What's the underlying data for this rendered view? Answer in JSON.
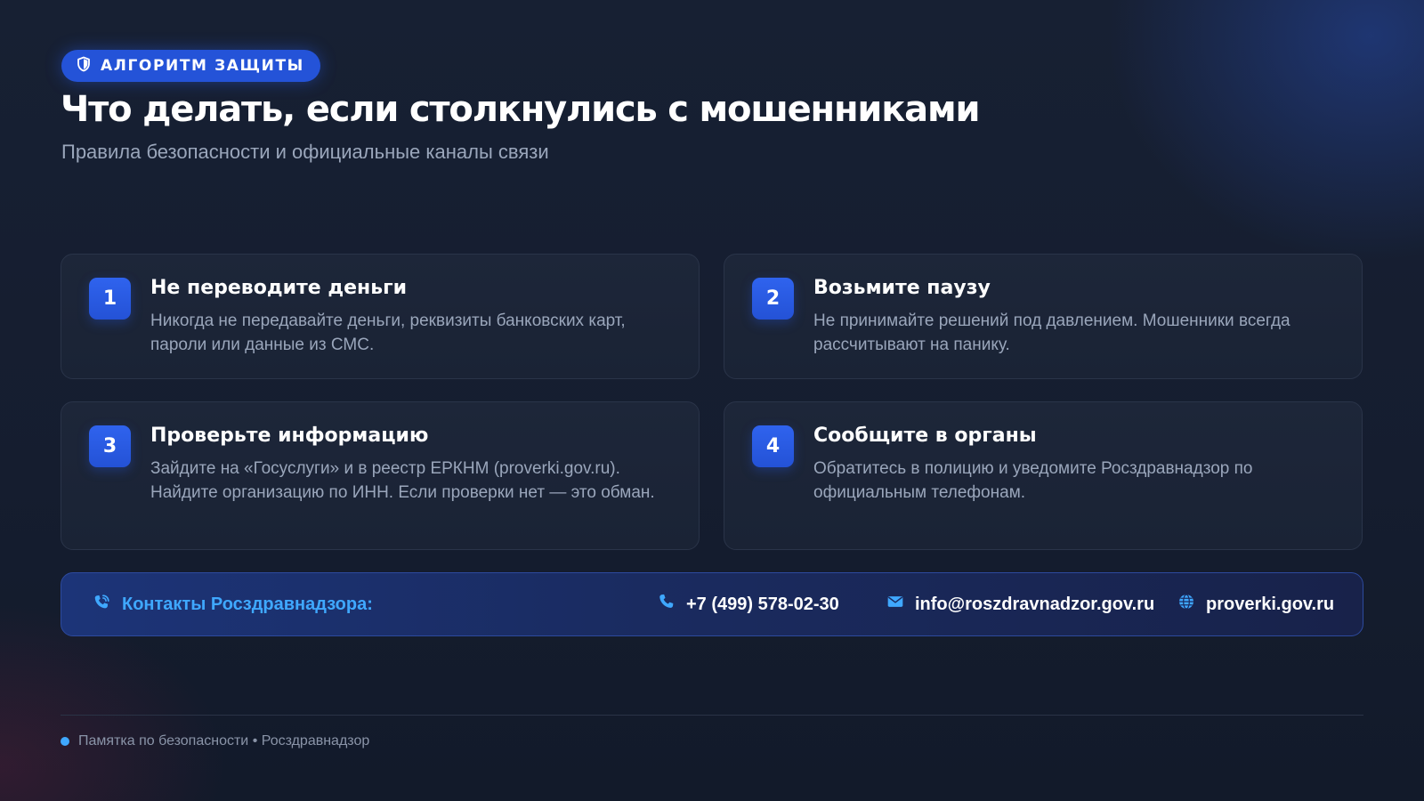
{
  "badge": {
    "label": "АЛГОРИТМ ЗАЩИТЫ",
    "icon": "shield-icon"
  },
  "title": "Что делать, если столкнулись с мошенниками",
  "subtitle": "Правила безопасности и официальные каналы связи",
  "steps": [
    {
      "number": "1",
      "title": "Не переводите деньги",
      "text": "Никогда не передавайте деньги, реквизиты банковских карт, пароли или данные из СМС."
    },
    {
      "number": "2",
      "title": "Возьмите паузу",
      "text": "Не принимайте решений под давлением. Мошенники всегда рассчитывают на панику."
    },
    {
      "number": "3",
      "title": "Проверьте информацию",
      "text": "Зайдите на «Госуслуги» и в реестр ЕРКНМ (proverki.gov.ru). Найдите организацию по ИНН. Если проверки нет — это обман."
    },
    {
      "number": "4",
      "title": "Сообщите в органы",
      "text": "Обратитесь в полицию и уведомите Росздравнадзор по официальным телефонам."
    }
  ],
  "contacts": {
    "label": "Контакты Росздравнадзора:",
    "icon": "phone-call-icon",
    "phone": {
      "value": "+7 (499) 578-02-30",
      "icon": "phone-icon"
    },
    "email": {
      "value": "info@roszdravnadzor.gov.ru",
      "icon": "envelope-icon"
    },
    "website": {
      "value": "proverki.gov.ru",
      "icon": "globe-icon"
    }
  },
  "footer": {
    "text": "Памятка по безопасности • Росздравнадзор"
  },
  "colors": {
    "accent": "#2453d8",
    "link": "#3fa8ff",
    "background": "#141c2e",
    "muted_text": "#9aa6bb"
  }
}
